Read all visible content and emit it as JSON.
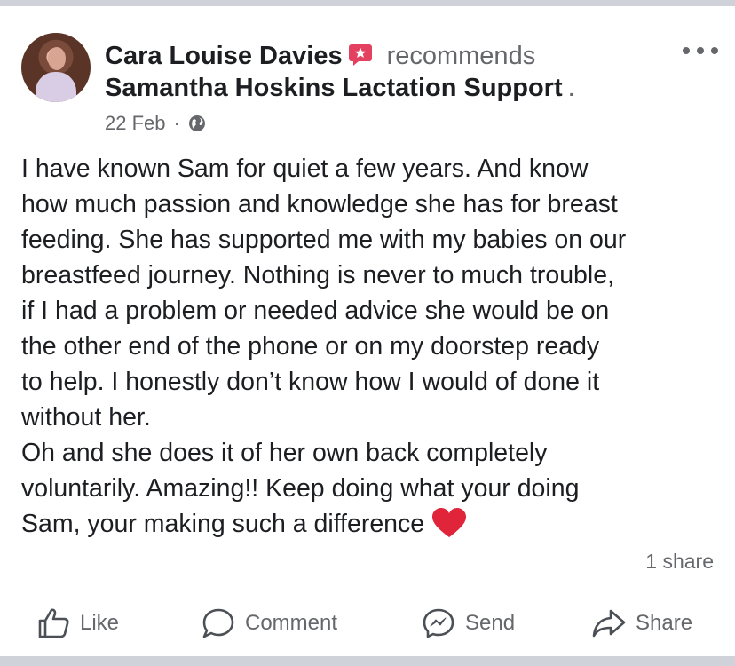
{
  "post": {
    "author": "Cara Louise Davies",
    "action_text": "recommends",
    "page_name": "Samantha Hoskins Lactation Support",
    "page_name_suffix": ".",
    "date": "22 Feb",
    "separator": "·",
    "privacy_icon": "globe-icon",
    "more_icon": "more-options-icon",
    "badge_icon": "recommendation-badge-icon",
    "badge_color": "#e4405f",
    "text_lines": [
      "I have known Sam for quiet a few years. And know",
      "how much passion and knowledge she has for breast",
      "feeding. She has supported me with my babies on our",
      "breastfeed journey. Nothing is never to much trouble,",
      "if I had a problem or needed advice she would be on",
      "the other end of the phone or on my doorstep ready",
      "to help. I honestly don’t know how I would of done it",
      "without her.",
      "Oh and she does it of her own back completely",
      "voluntarily. Amazing!! Keep doing what your doing",
      "Sam, your making such a difference"
    ],
    "end_emoji": "heart-icon",
    "heart_color": "#e0243a",
    "share_count": "1 share"
  },
  "actions": {
    "like": "Like",
    "comment": "Comment",
    "send": "Send",
    "share": "Share"
  }
}
